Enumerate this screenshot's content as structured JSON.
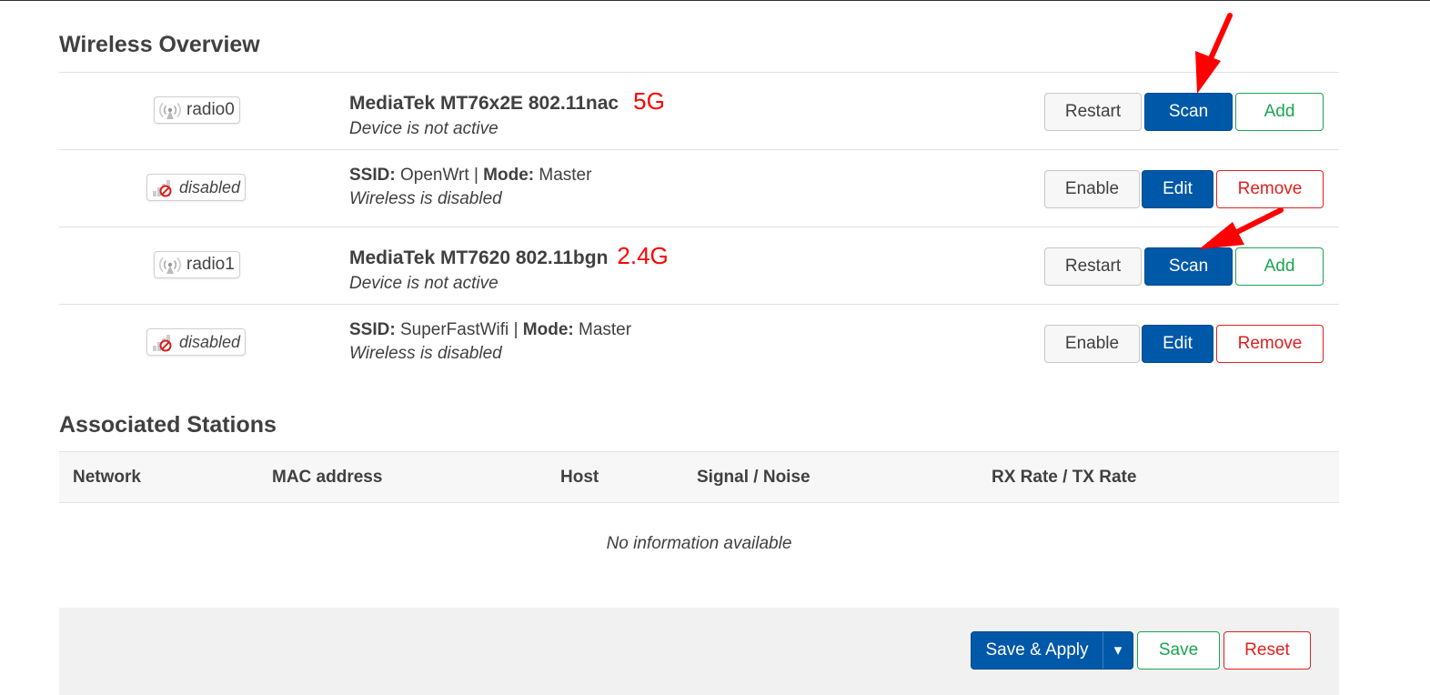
{
  "titles": {
    "wireless_overview": "Wireless Overview",
    "associated_stations": "Associated Stations"
  },
  "overview": {
    "radios": [
      {
        "device": {
          "badge": "radio0",
          "name": "MediaTek MT76x2E 802.11nac",
          "band_note": "5G",
          "status": "Device is not active",
          "buttons": {
            "restart": "Restart",
            "scan": "Scan",
            "add": "Add"
          }
        },
        "network": {
          "badge": "disabled",
          "ssid_label": "SSID:",
          "ssid": "OpenWrt",
          "separator": "|",
          "mode_label": "Mode:",
          "mode": "Master",
          "status": "Wireless is disabled",
          "buttons": {
            "enable": "Enable",
            "edit": "Edit",
            "remove": "Remove"
          }
        }
      },
      {
        "device": {
          "badge": "radio1",
          "name": "MediaTek MT7620 802.11bgn",
          "band_note": "2.4G",
          "status": "Device is not active",
          "buttons": {
            "restart": "Restart",
            "scan": "Scan",
            "add": "Add"
          }
        },
        "network": {
          "badge": "disabled",
          "ssid_label": "SSID:",
          "ssid": "SuperFastWifi",
          "separator": "|",
          "mode_label": "Mode:",
          "mode": "Master",
          "status": "Wireless is disabled",
          "buttons": {
            "enable": "Enable",
            "edit": "Edit",
            "remove": "Remove"
          }
        }
      }
    ]
  },
  "stations": {
    "columns": [
      "Network",
      "MAC address",
      "Host",
      "Signal / Noise",
      "RX Rate / TX Rate"
    ],
    "empty_message": "No information available"
  },
  "footer": {
    "save_apply": "Save & Apply",
    "dropdown_glyph": "▾",
    "save": "Save",
    "reset": "Reset"
  },
  "colors": {
    "primary_blue": "#0058a8",
    "add_green": "#1aa552",
    "remove_red": "#e02020",
    "annotation_red": "#ff0000"
  },
  "icons": {
    "device_badge": "wifi-signal-icon",
    "disabled_badge": "signal-disabled-icon",
    "annotation": "red-arrow-annotation"
  }
}
